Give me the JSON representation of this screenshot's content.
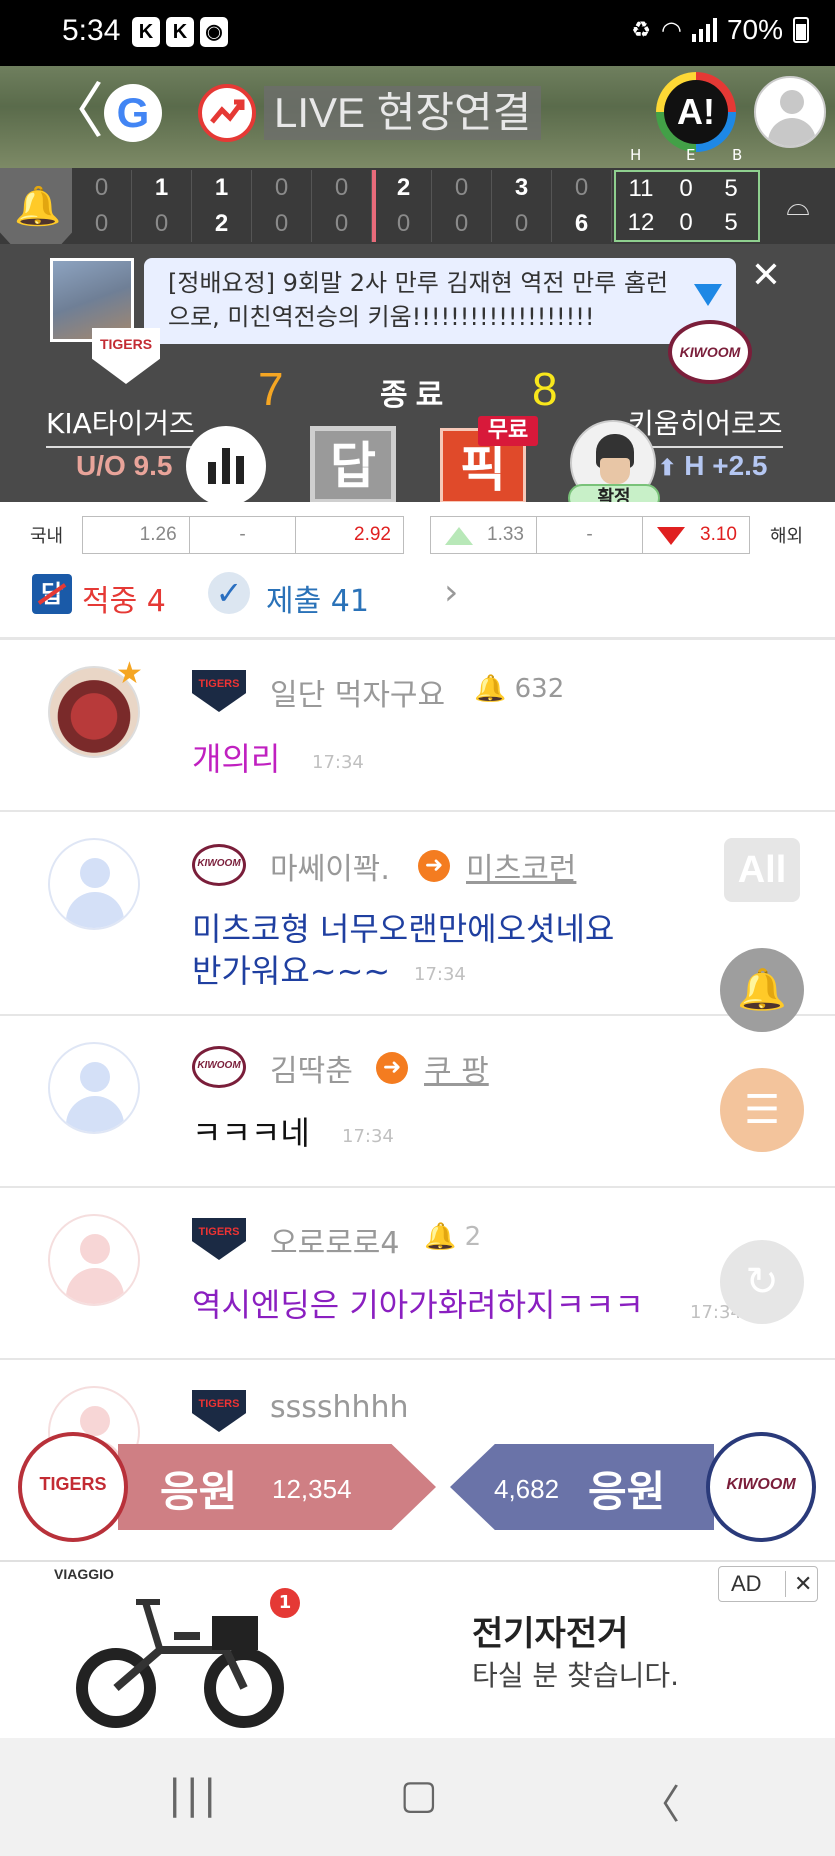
{
  "status_bar": {
    "time": "5:34",
    "left_icons": [
      "K",
      "K",
      "map"
    ],
    "battery": "70%"
  },
  "header": {
    "google_label": "G",
    "live_label": "LIVE 현장연결",
    "ai_label": "A!"
  },
  "scoreboard": {
    "rhe_headers": [
      "H",
      "E",
      "B"
    ],
    "away_innings": [
      "0",
      "1",
      "1",
      "0",
      "0",
      "2",
      "0",
      "3",
      "0"
    ],
    "home_innings": [
      "0",
      "0",
      "2",
      "0",
      "0",
      "0",
      "0",
      "0",
      "6"
    ],
    "away_rhe": [
      "11",
      "0",
      "5"
    ],
    "home_rhe": [
      "12",
      "0",
      "5"
    ]
  },
  "game": {
    "banner_text": "[정배요정] 9회말 2사 만루 김재현 역전 만루 홈런으로, 미친역전승의 키움!!!!!!!!!!!!!!!!!!!",
    "away_team": "KIA타이거즈",
    "home_team": "키움히어로즈",
    "away_score": "7",
    "home_score": "8",
    "status": "종료",
    "over_under": "U/O 9.5",
    "handicap": "H +2.5",
    "dap_label": "답",
    "pick_label": "픽",
    "free_label": "무료",
    "confirmed_label": "확정",
    "kia_logo_text": "TIGERS",
    "kiwoom_logo_text": "KIWOOM"
  },
  "odds": {
    "domestic_label": "국내",
    "overseas_label": "해외",
    "domestic": [
      "1.26",
      "-",
      "2.92"
    ],
    "overseas": [
      "1.33",
      "-",
      "3.10"
    ]
  },
  "stats": {
    "hit_label": "적중 4",
    "submit_label": "제출 41"
  },
  "chat": [
    {
      "nick": "일단 먹자구요",
      "bell_count": "632",
      "text": "개의리",
      "time": "17:34",
      "text_color": "#c020c0"
    },
    {
      "nick": "마쎄이꽉.",
      "target": "미츠코런",
      "text_line1": "미츠코형 너무오랜만에오셧네요",
      "text_line2": "반가워요~~~",
      "time": "17:34",
      "text_color": "#1f3fa0"
    },
    {
      "nick": "김딱춘",
      "target": "쿠 팡",
      "text": "ㅋㅋㅋ네",
      "time": "17:34",
      "text_color": "#111111"
    },
    {
      "nick": "오로로로4",
      "bell_count": "2",
      "text": "역시엔딩은 기아가화려하지ㅋㅋㅋ",
      "time": "17:34",
      "text_color": "#8a1fc0"
    },
    {
      "nick": "sssshhhh"
    }
  ],
  "fabs": {
    "all_label": "All"
  },
  "cheer": {
    "left_label": "응원",
    "left_count": "12,354",
    "right_label": "응원",
    "right_count": "4,682"
  },
  "ad": {
    "brand": "VIAGGIO",
    "badge": "1",
    "title": "전기자전거",
    "subtitle": "타실 분 찾습니다.",
    "ad_label": "AD"
  }
}
